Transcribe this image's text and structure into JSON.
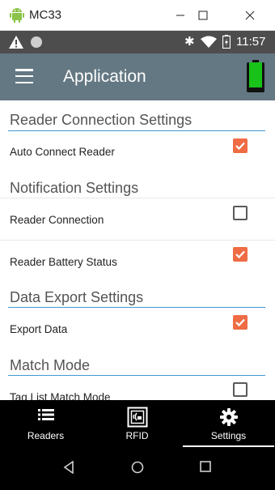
{
  "window": {
    "title": "MC33"
  },
  "status_bar": {
    "time": "11:57"
  },
  "app_bar": {
    "title": "Application"
  },
  "sections": [
    {
      "title": "Reader Connection Settings",
      "items": [
        {
          "label": "Auto Connect Reader",
          "checked": true
        }
      ]
    },
    {
      "title": "Notification Settings",
      "items": [
        {
          "label": "Reader Connection",
          "checked": false
        },
        {
          "label": "Reader Battery Status",
          "checked": true
        }
      ]
    },
    {
      "title": "Data Export Settings",
      "items": [
        {
          "label": "Export Data",
          "checked": true
        }
      ]
    },
    {
      "title": "Match Mode",
      "items": [
        {
          "label": "Tag List Match Mode",
          "checked": false
        }
      ]
    }
  ],
  "bottom_nav": [
    {
      "label": "Readers",
      "icon": "list-icon",
      "active": false
    },
    {
      "label": "RFID",
      "icon": "rfid-icon",
      "active": false
    },
    {
      "label": "Settings",
      "icon": "gear-icon",
      "active": true
    }
  ],
  "colors": {
    "app_bar": "#647883",
    "accent_checkbox": "#ef6c45",
    "section_line": "#3f9bd1",
    "battery_fill": "#19c219"
  }
}
